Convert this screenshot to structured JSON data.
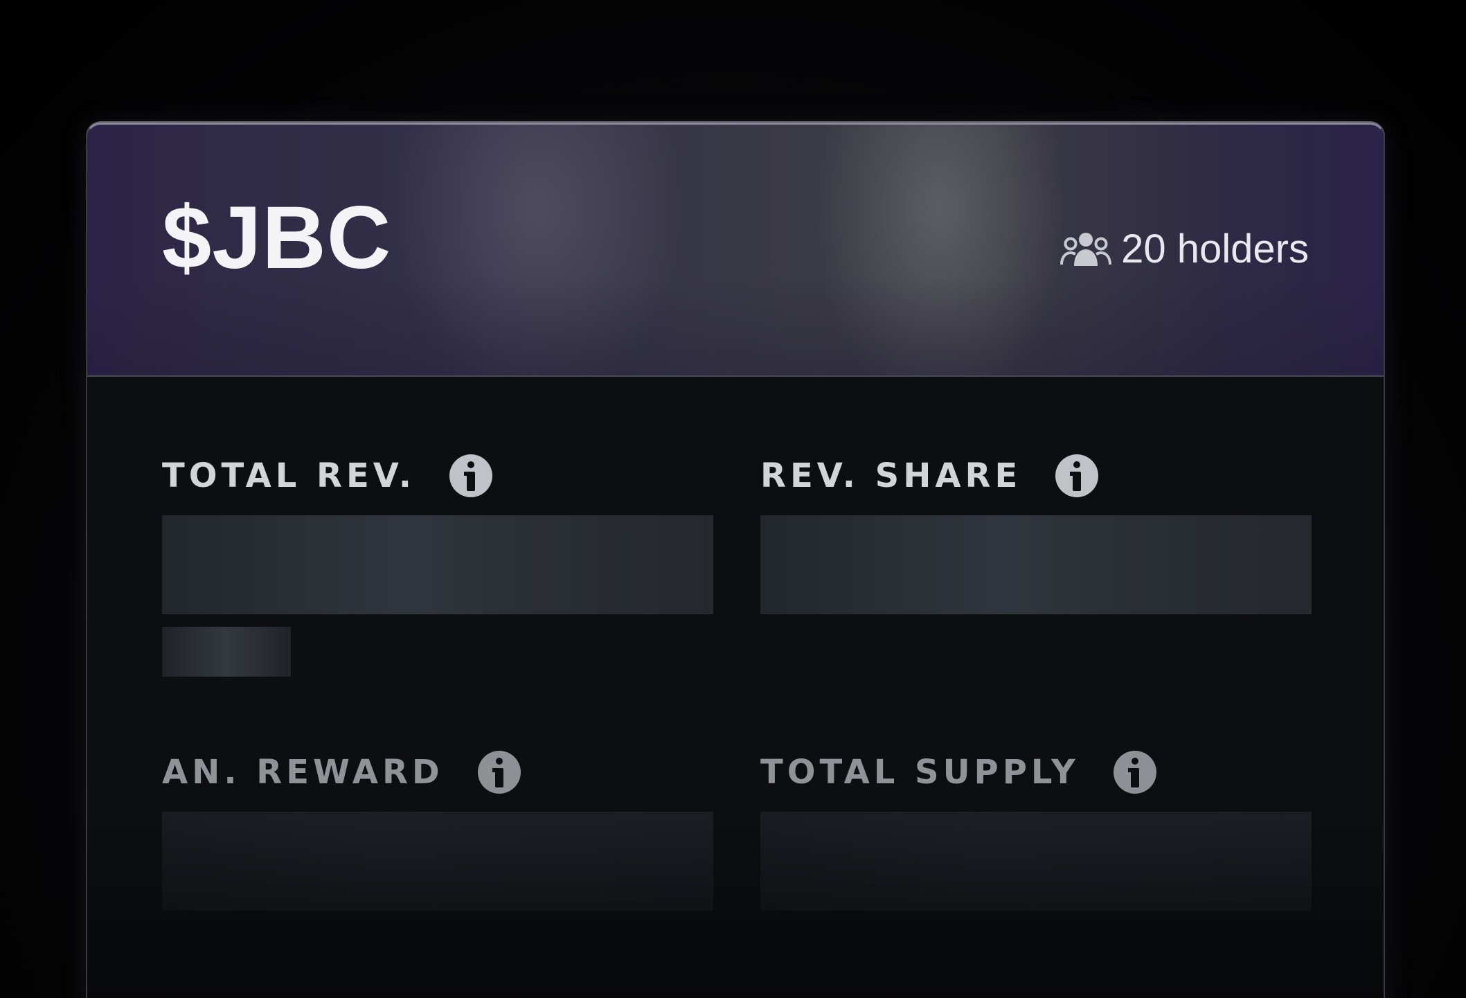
{
  "token": {
    "ticker": "$JBC",
    "holders_label": "20 holders",
    "holders_icon": "users-icon"
  },
  "stats": [
    {
      "label": "TOTAL REV.",
      "icon": "info-icon",
      "value": ""
    },
    {
      "label": "REV. SHARE",
      "icon": "info-icon",
      "value": ""
    },
    {
      "label": "AN. REWARD",
      "icon": "info-icon",
      "value": ""
    },
    {
      "label": "TOTAL SUPPLY",
      "icon": "info-icon",
      "value": ""
    }
  ],
  "colors": {
    "header_accent": "#2d2347",
    "card_background": "#0c0e12",
    "skeleton": "#2a2f36",
    "label": "#d2d4d8"
  }
}
